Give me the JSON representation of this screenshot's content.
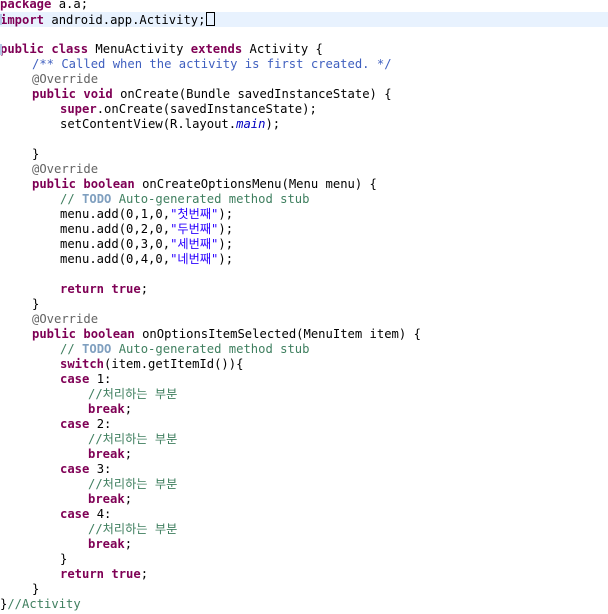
{
  "editor": {
    "lines": {
      "l1": {
        "kw": "package",
        "rest": " a.a;"
      },
      "l2": {
        "kw": "import",
        "rest": " android.app.Activity;"
      },
      "l4": {
        "kw1": "public",
        "kw2": "class",
        "name": " MenuActivity ",
        "kw3": "extends",
        "rest": " Activity {"
      },
      "l5": {
        "doc": "/** Called when the activity is first created. */"
      },
      "l6": {
        "ann": "@Override"
      },
      "l7": {
        "kw1": "public",
        "kw2": "void",
        "rest": " onCreate(Bundle savedInstanceState) {"
      },
      "l8": {
        "kw": "super",
        "rest": ".onCreate(savedInstanceState);"
      },
      "l9": {
        "pre": "setContentView(R.layout.",
        "field": "main",
        "post": ");"
      },
      "l11": {
        "text": "}"
      },
      "l12": {
        "ann": "@Override"
      },
      "l13": {
        "kw1": "public",
        "kw2": "boolean",
        "rest": " onCreateOptionsMenu(Menu menu) {"
      },
      "l14": {
        "c1": "// ",
        "todo": "TODO",
        "c2": " Auto-generated method stub"
      },
      "l15": {
        "pre": "menu.add(0,1,0,",
        "str": "\"첫번째\"",
        "post": ");"
      },
      "l16": {
        "pre": "menu.add(0,2,0,",
        "str": "\"두번째\"",
        "post": ");"
      },
      "l17": {
        "pre": "menu.add(0,3,0,",
        "str": "\"세번째\"",
        "post": ");"
      },
      "l18": {
        "pre": "menu.add(0,4,0,",
        "str": "\"네번째\"",
        "post": ");"
      },
      "l20": {
        "kw1": "return",
        "kw2": "true",
        "post": ";"
      },
      "l21": {
        "text": "}"
      },
      "l22": {
        "ann": "@Override"
      },
      "l23": {
        "kw1": "public",
        "kw2": "boolean",
        "rest": " onOptionsItemSelected(MenuItem item) {"
      },
      "l24": {
        "c1": "// ",
        "todo": "TODO",
        "c2": " Auto-generated method stub"
      },
      "l25": {
        "kw": "switch",
        "rest": "(item.getItemId()){"
      },
      "l26": {
        "kw": "case",
        "rest": " 1:"
      },
      "l27": {
        "cmt": "//처리하는 부분"
      },
      "l28": {
        "kw": "break",
        "rest": ";"
      },
      "l29": {
        "kw": "case",
        "rest": " 2:"
      },
      "l30": {
        "cmt": "//처리하는 부분"
      },
      "l31": {
        "kw": "break",
        "rest": ";"
      },
      "l32": {
        "kw": "case",
        "rest": " 3:"
      },
      "l33": {
        "cmt": "//처리하는 부분"
      },
      "l34": {
        "kw": "break",
        "rest": ";"
      },
      "l35": {
        "kw": "case",
        "rest": " 4:"
      },
      "l36": {
        "cmt": "//처리하는 부분"
      },
      "l37": {
        "kw": "break",
        "rest": ";"
      },
      "l38": {
        "text": "}"
      },
      "l39": {
        "kw1": "return",
        "kw2": "true",
        "post": ";"
      },
      "l40": {
        "text": "}"
      },
      "l41": {
        "text": "}",
        "cmt": "//Activity"
      }
    }
  }
}
